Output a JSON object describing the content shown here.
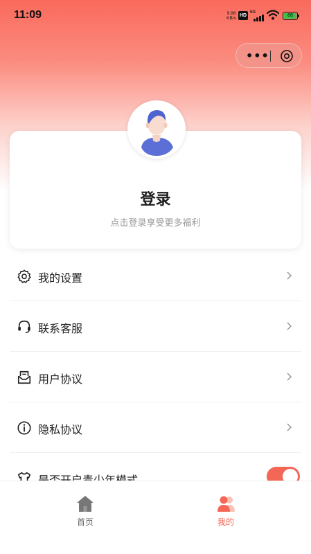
{
  "status_bar": {
    "time": "11:09",
    "net_speed_value": "9.88",
    "net_speed_unit": "KB/s",
    "hd": "HD",
    "network": "5G",
    "battery": "88"
  },
  "capsule": {
    "more_icon": "more-dots-icon",
    "close_icon": "close-circle-icon"
  },
  "profile": {
    "avatar_icon": "default-avatar-icon",
    "login_title": "登录",
    "login_subtitle": "点击登录享受更多福利"
  },
  "menu": {
    "items": [
      {
        "label": "我的设置",
        "icon": "gear-icon"
      },
      {
        "label": "联系客服",
        "icon": "headset-icon"
      },
      {
        "label": "用户协议",
        "icon": "agreement-icon"
      },
      {
        "label": "隐私协议",
        "icon": "info-icon"
      },
      {
        "label": "是否开启青少年模式",
        "icon": "shirt-icon"
      }
    ]
  },
  "teen_mode_toggle": {
    "on": true
  },
  "tab_bar": {
    "tabs": [
      {
        "label": "首页",
        "icon": "home-icon",
        "active": false
      },
      {
        "label": "我的",
        "icon": "user-icon",
        "active": true
      }
    ]
  },
  "colors": {
    "accent": "#f46656",
    "header_gradient_top": "#f96a5c",
    "inactive_tab": "#666666"
  }
}
